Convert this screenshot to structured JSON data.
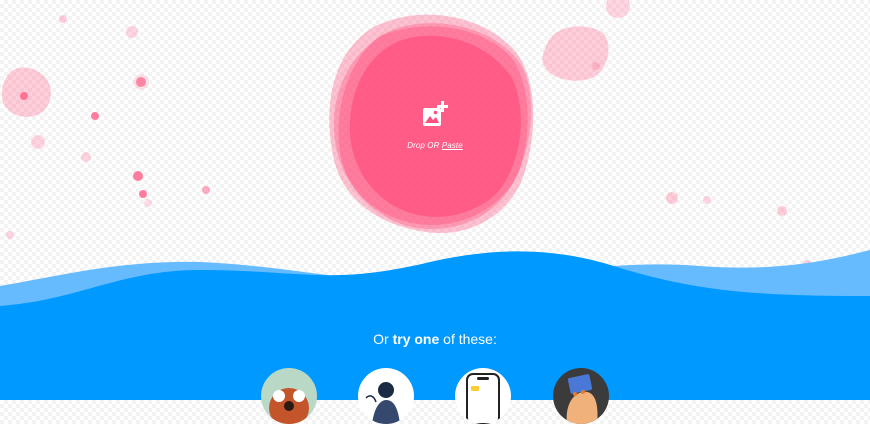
{
  "dropzone": {
    "drop_label": "Drop OR ",
    "paste_label": "Paste",
    "icon": "add-image-icon",
    "color": "#ff4f7e"
  },
  "samples": {
    "heading_prefix": "Or ",
    "heading_bold": "try one",
    "heading_suffix": " of these:",
    "items": [
      {
        "icon": "red-panda-photo"
      },
      {
        "icon": "illustration-photo"
      },
      {
        "icon": "phone-screenshot-photo"
      },
      {
        "icon": "hand-holding-card-photo"
      }
    ]
  },
  "colors": {
    "accent_pink": "#ff4f7e",
    "wave_blue": "#0099ff",
    "wave_light_blue": "#66bbff",
    "text_white": "#ffffff"
  }
}
